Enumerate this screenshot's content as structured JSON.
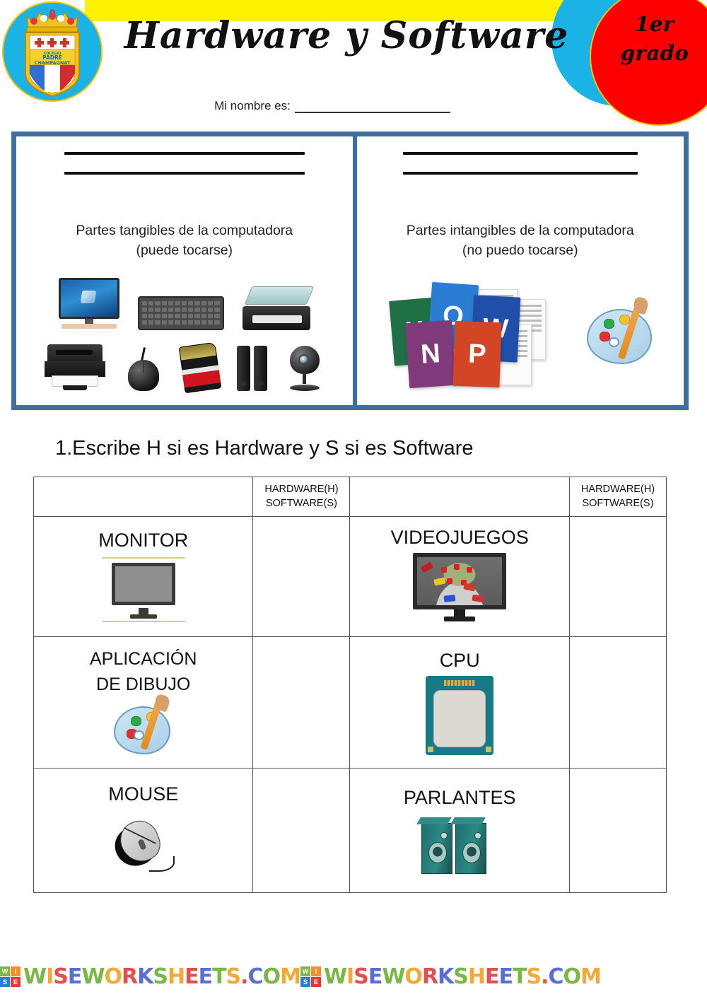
{
  "header": {
    "title": "Hardware y Software",
    "grade_line1": "1er",
    "grade_line2": "grado",
    "name_label": "Mi nombre es:",
    "logo_name": "padre-champagnat-crest",
    "colors": {
      "yellow": "#FFF200",
      "cyan": "#1BB3E6",
      "red": "#FF0000",
      "box_blue": "#3E6FA0"
    }
  },
  "concept_boxes": [
    {
      "id": "tangible",
      "caption_line1": "Partes tangibles de la computadora",
      "caption_line2": "(puede tocarse)",
      "blank_lines": 2,
      "images": [
        "monitor",
        "keyboard",
        "scanner",
        "printer",
        "mouse",
        "sd-card",
        "speakers",
        "webcam"
      ]
    },
    {
      "id": "intangible",
      "caption_line1": "Partes intangibles de la computadora",
      "caption_line2": "(no puedo tocarse)",
      "blank_lines": 2,
      "images": [
        "microsoft-office-apps",
        "paint-palette"
      ],
      "office_tiles": [
        {
          "letter": "X",
          "color": "#1f7145"
        },
        {
          "letter": "O",
          "color": "#2b7cd3"
        },
        {
          "letter": "W",
          "color": "#1f4fa8"
        },
        {
          "letter": "N",
          "color": "#80397b"
        },
        {
          "letter": "P",
          "color": "#d24625"
        }
      ]
    }
  ],
  "exercise": {
    "instruction": "1.Escribe H si es Hardware y S si es Software",
    "answer_header_line1": "HARDWARE(H)",
    "answer_header_line2": "SOFTWARE(S)",
    "rows": [
      {
        "left": {
          "label": "MONITOR",
          "icon": "flat-monitor-icon",
          "answer": ""
        },
        "right": {
          "label": "VIDEOJUEGOS",
          "icon": "racing-videogame-icon",
          "answer": ""
        }
      },
      {
        "left": {
          "label": "APLICACIÓN",
          "label2": "DE DIBUJO",
          "icon": "paint-palette-icon",
          "answer": ""
        },
        "right": {
          "label": "CPU",
          "icon": "cpu-chip-icon",
          "answer": ""
        }
      },
      {
        "left": {
          "label": "MOUSE",
          "icon": "mouse-icon",
          "answer": ""
        },
        "right": {
          "label": "PARLANTES",
          "icon": "speakers-icon",
          "answer": ""
        }
      }
    ]
  },
  "footer": {
    "watermark_text": "WISEWORKSHEETS.COM",
    "logo_letters": [
      "WI",
      "SE"
    ],
    "repeats": 2
  }
}
